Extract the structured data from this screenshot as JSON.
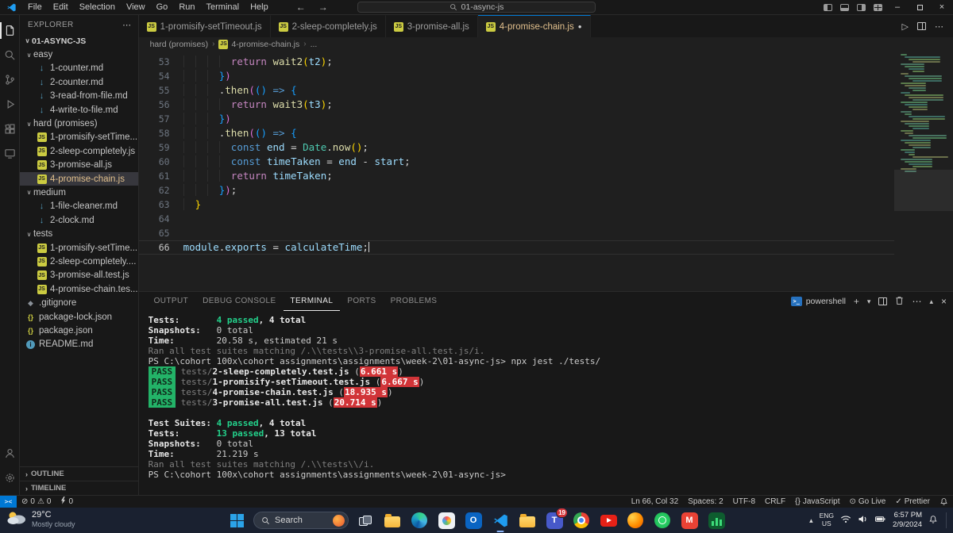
{
  "titlebar": {
    "menus": [
      "File",
      "Edit",
      "Selection",
      "View",
      "Go",
      "Run",
      "Terminal",
      "Help"
    ],
    "search_value": "01-async-js"
  },
  "activity_bar": {
    "top": [
      {
        "name": "files",
        "active": true
      },
      {
        "name": "search"
      },
      {
        "name": "source-control"
      },
      {
        "name": "run-debug"
      },
      {
        "name": "extensions"
      },
      {
        "name": "remote"
      }
    ],
    "bottom": [
      {
        "name": "account"
      },
      {
        "name": "settings"
      }
    ]
  },
  "sidebar": {
    "title": "EXPLORER",
    "root": "01-ASYNC-JS",
    "items": [
      {
        "label": "easy",
        "type": "folder",
        "indent": 0,
        "expanded": true
      },
      {
        "label": "1-counter.md",
        "type": "md",
        "indent": 1
      },
      {
        "label": "2-counter.md",
        "type": "md",
        "indent": 1
      },
      {
        "label": "3-read-from-file.md",
        "type": "md",
        "indent": 1
      },
      {
        "label": "4-write-to-file.md",
        "type": "md",
        "indent": 1
      },
      {
        "label": "hard (promises)",
        "type": "folder",
        "indent": 0,
        "expanded": true
      },
      {
        "label": "1-promisify-setTime...",
        "type": "js",
        "indent": 1
      },
      {
        "label": "2-sleep-completely.js",
        "type": "js",
        "indent": 1
      },
      {
        "label": "3-promise-all.js",
        "type": "js",
        "indent": 1
      },
      {
        "label": "4-promise-chain.js",
        "type": "js",
        "indent": 1,
        "selected": true
      },
      {
        "label": "medium",
        "type": "folder",
        "indent": 0,
        "expanded": true
      },
      {
        "label": "1-file-cleaner.md",
        "type": "md",
        "indent": 1
      },
      {
        "label": "2-clock.md",
        "type": "md",
        "indent": 1
      },
      {
        "label": "tests",
        "type": "folder",
        "indent": 0,
        "expanded": true
      },
      {
        "label": "1-promisify-setTime...",
        "type": "js",
        "indent": 1
      },
      {
        "label": "2-sleep-completely....",
        "type": "js",
        "indent": 1
      },
      {
        "label": "3-promise-all.test.js",
        "type": "js",
        "indent": 1
      },
      {
        "label": "4-promise-chain.tes...",
        "type": "js",
        "indent": 1
      },
      {
        "label": ".gitignore",
        "type": "git",
        "indent": 0
      },
      {
        "label": "package-lock.json",
        "type": "json",
        "indent": 0
      },
      {
        "label": "package.json",
        "type": "json",
        "indent": 0
      },
      {
        "label": "README.md",
        "type": "info",
        "indent": 0
      }
    ],
    "bottom_sections": [
      "OUTLINE",
      "TIMELINE"
    ]
  },
  "editor_tabs": [
    {
      "label": "1-promisify-setTimeout.js",
      "icon": "js",
      "active": false
    },
    {
      "label": "2-sleep-completely.js",
      "icon": "js",
      "active": false
    },
    {
      "label": "3-promise-all.js",
      "icon": "js",
      "active": false
    },
    {
      "label": "4-promise-chain.js",
      "icon": "js",
      "active": true,
      "dirty": true
    }
  ],
  "breadcrumb": [
    "hard (promises)",
    "4-promise-chain.js",
    "..."
  ],
  "editor": {
    "lines": [
      {
        "n": 53,
        "tokens": [
          [
            "        ",
            "ws"
          ],
          [
            "return",
            "kw"
          ],
          [
            " ",
            "sp"
          ],
          [
            "wait2",
            "fn"
          ],
          [
            "(",
            "b1"
          ],
          [
            "t2",
            "vr"
          ],
          [
            ")",
            "b1"
          ],
          [
            ";",
            "pn"
          ]
        ]
      },
      {
        "n": 54,
        "tokens": [
          [
            "      ",
            "ws"
          ],
          [
            "}",
            "b3"
          ],
          [
            ")",
            "b2"
          ]
        ]
      },
      {
        "n": 55,
        "tokens": [
          [
            "      ",
            "ws"
          ],
          [
            ".",
            "pn"
          ],
          [
            "then",
            "fn"
          ],
          [
            "(",
            "b2"
          ],
          [
            "(",
            "b3"
          ],
          [
            ")",
            "b3"
          ],
          [
            " ",
            "sp"
          ],
          [
            "=>",
            "kw2"
          ],
          [
            " ",
            "sp"
          ],
          [
            "{",
            "b3"
          ]
        ]
      },
      {
        "n": 56,
        "tokens": [
          [
            "        ",
            "ws"
          ],
          [
            "return",
            "kw"
          ],
          [
            " ",
            "sp"
          ],
          [
            "wait3",
            "fn"
          ],
          [
            "(",
            "b1"
          ],
          [
            "t3",
            "vr"
          ],
          [
            ")",
            "b1"
          ],
          [
            ";",
            "pn"
          ]
        ]
      },
      {
        "n": 57,
        "tokens": [
          [
            "      ",
            "ws"
          ],
          [
            "}",
            "b3"
          ],
          [
            ")",
            "b2"
          ]
        ]
      },
      {
        "n": 58,
        "tokens": [
          [
            "      ",
            "ws"
          ],
          [
            ".",
            "pn"
          ],
          [
            "then",
            "fn"
          ],
          [
            "(",
            "b2"
          ],
          [
            "(",
            "b3"
          ],
          [
            ")",
            "b3"
          ],
          [
            " ",
            "sp"
          ],
          [
            "=>",
            "kw2"
          ],
          [
            " ",
            "sp"
          ],
          [
            "{",
            "b3"
          ]
        ]
      },
      {
        "n": 59,
        "tokens": [
          [
            "        ",
            "ws"
          ],
          [
            "const",
            "kw2"
          ],
          [
            " ",
            "sp"
          ],
          [
            "end",
            "vr"
          ],
          [
            " ",
            "sp"
          ],
          [
            "=",
            "pn"
          ],
          [
            " ",
            "sp"
          ],
          [
            "Date",
            "cl"
          ],
          [
            ".",
            "pn"
          ],
          [
            "now",
            "fn"
          ],
          [
            "(",
            "b1"
          ],
          [
            ")",
            "b1"
          ],
          [
            ";",
            "pn"
          ]
        ]
      },
      {
        "n": 60,
        "tokens": [
          [
            "        ",
            "ws"
          ],
          [
            "const",
            "kw2"
          ],
          [
            " ",
            "sp"
          ],
          [
            "timeTaken",
            "vr"
          ],
          [
            " ",
            "sp"
          ],
          [
            "=",
            "pn"
          ],
          [
            " ",
            "sp"
          ],
          [
            "end",
            "vr"
          ],
          [
            " ",
            "sp"
          ],
          [
            "-",
            "pn"
          ],
          [
            " ",
            "sp"
          ],
          [
            "start",
            "vr"
          ],
          [
            ";",
            "pn"
          ]
        ]
      },
      {
        "n": 61,
        "tokens": [
          [
            "        ",
            "ws"
          ],
          [
            "return",
            "kw"
          ],
          [
            " ",
            "sp"
          ],
          [
            "timeTaken",
            "vr"
          ],
          [
            ";",
            "pn"
          ]
        ]
      },
      {
        "n": 62,
        "tokens": [
          [
            "      ",
            "ws"
          ],
          [
            "}",
            "b3"
          ],
          [
            ")",
            "b2"
          ],
          [
            ";",
            "pn"
          ]
        ]
      },
      {
        "n": 63,
        "tokens": [
          [
            "  ",
            "ws"
          ],
          [
            "}",
            "b1"
          ]
        ]
      },
      {
        "n": 64,
        "tokens": []
      },
      {
        "n": 65,
        "tokens": []
      },
      {
        "n": 66,
        "current": true,
        "cursor": true,
        "tokens": [
          [
            "module",
            "vr"
          ],
          [
            ".",
            "pn"
          ],
          [
            "exports",
            "vr"
          ],
          [
            " ",
            "sp"
          ],
          [
            "=",
            "pn"
          ],
          [
            " ",
            "sp"
          ],
          [
            "calculateTime",
            "vr"
          ],
          [
            ";",
            "pn"
          ]
        ]
      }
    ]
  },
  "panel": {
    "tabs": [
      {
        "label": "OUTPUT"
      },
      {
        "label": "DEBUG CONSOLE"
      },
      {
        "label": "TERMINAL",
        "active": true
      },
      {
        "label": "PORTS"
      },
      {
        "label": "PROBLEMS"
      }
    ],
    "shell_label": "powershell",
    "terminal": [
      [
        [
          "Tests:       ",
          "lb"
        ],
        [
          "4 passed",
          "g"
        ],
        [
          ", 4 total",
          "lb"
        ]
      ],
      [
        [
          "Snapshots:   ",
          "lb"
        ],
        [
          "0 total",
          "d"
        ]
      ],
      [
        [
          "Time:        ",
          "lb"
        ],
        [
          "20.58 s, estimated 21 s",
          "d"
        ]
      ],
      [
        [
          "Ran all test suites matching /.\\\\tests\\\\3-promise-all.test.js/i.",
          "dim"
        ]
      ],
      [
        [
          "PS C:\\cohort 100x\\cohort assignments\\assignments\\week-2\\01-async-js> ",
          "d"
        ],
        [
          "npx jest ./tests/",
          "d"
        ]
      ],
      [
        [
          "PASS",
          "pass"
        ],
        [
          " ",
          "d"
        ],
        [
          "tests/",
          "dim"
        ],
        [
          "2-sleep-completely.test.js",
          "lb"
        ],
        [
          " (",
          "d"
        ],
        [
          "6.661 s",
          "slow"
        ],
        [
          ")",
          "d"
        ]
      ],
      [
        [
          "PASS",
          "pass"
        ],
        [
          " ",
          "d"
        ],
        [
          "tests/",
          "dim"
        ],
        [
          "1-promisify-setTimeout.test.js",
          "lb"
        ],
        [
          " (",
          "d"
        ],
        [
          "6.667 s",
          "slow"
        ],
        [
          ")",
          "d"
        ]
      ],
      [
        [
          "PASS",
          "pass"
        ],
        [
          " ",
          "d"
        ],
        [
          "tests/",
          "dim"
        ],
        [
          "4-promise-chain.test.js",
          "lb"
        ],
        [
          " (",
          "d"
        ],
        [
          "18.935 s",
          "slow"
        ],
        [
          ")",
          "d"
        ]
      ],
      [
        [
          "PASS",
          "pass"
        ],
        [
          " ",
          "d"
        ],
        [
          "tests/",
          "dim"
        ],
        [
          "3-promise-all.test.js",
          "lb"
        ],
        [
          " (",
          "d"
        ],
        [
          "20.714 s",
          "slow"
        ],
        [
          ")",
          "d"
        ]
      ],
      [],
      [
        [
          "Test Suites: ",
          "lb"
        ],
        [
          "4 passed",
          "g"
        ],
        [
          ", 4 total",
          "lb"
        ]
      ],
      [
        [
          "Tests:       ",
          "lb"
        ],
        [
          "13 passed",
          "g"
        ],
        [
          ", 13 total",
          "lb"
        ]
      ],
      [
        [
          "Snapshots:   ",
          "lb"
        ],
        [
          "0 total",
          "d"
        ]
      ],
      [
        [
          "Time:        ",
          "lb"
        ],
        [
          "21.219 s",
          "d"
        ]
      ],
      [
        [
          "Ran all test suites matching /.\\\\tests\\\\/i.",
          "dim"
        ]
      ],
      [
        [
          "PS C:\\cohort 100x\\cohort assignments\\assignments\\week-2\\01-async-js> ",
          "d"
        ]
      ]
    ]
  },
  "status_bar": {
    "remote_label": "><",
    "errors": "0",
    "warnings": "0",
    "ports": "0",
    "right": [
      {
        "id": "cursor-position",
        "label": "Ln 66, Col 32"
      },
      {
        "id": "indentation",
        "label": "Spaces: 2"
      },
      {
        "id": "encoding",
        "label": "UTF-8"
      },
      {
        "id": "eol",
        "label": "CRLF"
      },
      {
        "id": "language-mode",
        "icon": "braces",
        "label": "JavaScript"
      },
      {
        "id": "go-live",
        "icon": "broadcast",
        "label": "Go Live"
      },
      {
        "id": "prettier",
        "icon": "check",
        "label": "Prettier"
      }
    ]
  },
  "taskbar": {
    "weather": {
      "temp": "29°C",
      "condition": "Mostly cloudy"
    },
    "search_label": "Search",
    "apps": [
      {
        "name": "task-view"
      },
      {
        "name": "file-explorer"
      },
      {
        "name": "edge"
      },
      {
        "name": "photos"
      },
      {
        "name": "outlook"
      },
      {
        "name": "vscode",
        "active": true
      },
      {
        "name": "folder"
      },
      {
        "name": "teams",
        "badge": "19"
      },
      {
        "name": "chrome"
      },
      {
        "name": "youtube"
      },
      {
        "name": "firefox"
      },
      {
        "name": "whatsapp"
      },
      {
        "name": "gmail"
      },
      {
        "name": "excel"
      }
    ],
    "tray": {
      "lang": "ENG",
      "region": "US",
      "time": "6:57 PM",
      "date": "2/9/2024"
    }
  }
}
